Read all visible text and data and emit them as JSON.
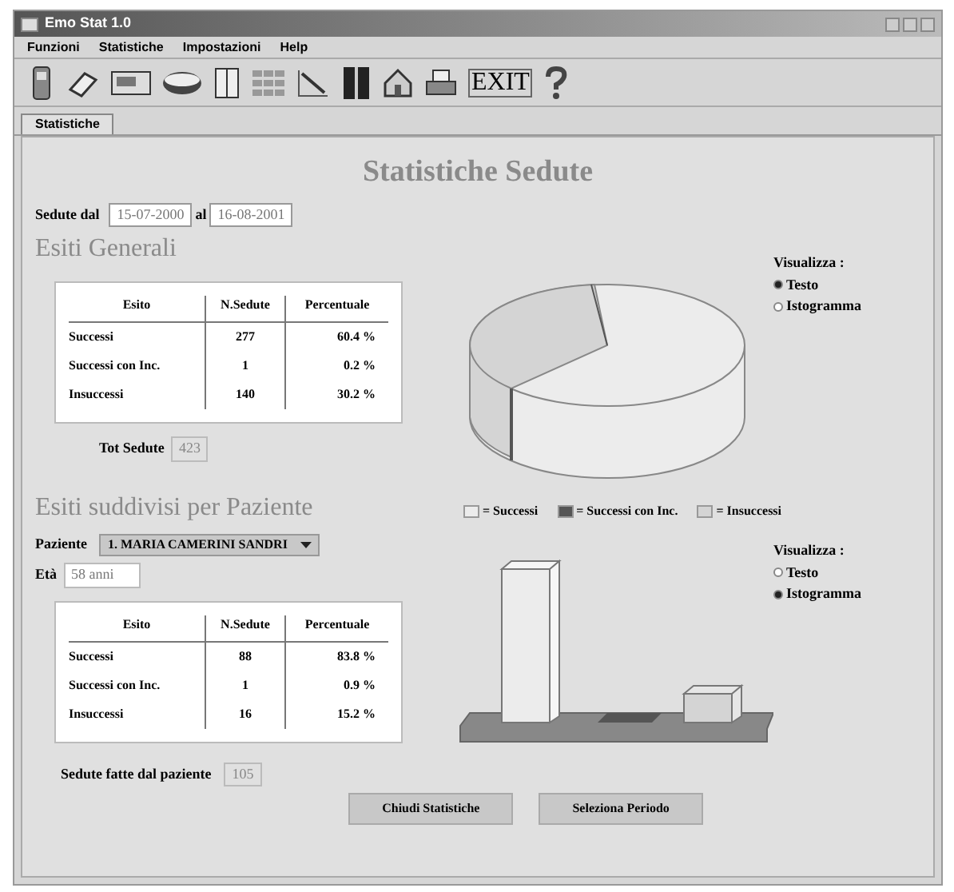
{
  "window": {
    "title": "Emo Stat 1.0"
  },
  "menu": [
    "Funzioni",
    "Statistiche",
    "Impostazioni",
    "Help"
  ],
  "toolbar": {
    "exit_label": "EXIT"
  },
  "tabs": [
    {
      "label": "Statistiche",
      "selected": true
    }
  ],
  "heading": "Statistiche Sedute",
  "period": {
    "label": "Sedute dal",
    "from": "15-07-2000",
    "sep": "al",
    "to": "16-08-2001"
  },
  "general": {
    "title": "Esiti Generali",
    "columns": [
      "Esito",
      "N.Sedute",
      "Percentuale"
    ],
    "rows": [
      [
        "Successi",
        "277",
        "60.4 %"
      ],
      [
        "Successi con Inc.",
        "1",
        "0.2 %"
      ],
      [
        "Insuccessi",
        "140",
        "30.2 %"
      ]
    ],
    "total_label": "Tot Sedute",
    "total": "423",
    "view": {
      "label": "Visualizza :",
      "options": [
        {
          "label": "Testo",
          "selected": true
        },
        {
          "label": "Istogramma",
          "selected": false
        }
      ]
    }
  },
  "legend": [
    {
      "label": "= Successi",
      "color": "#ececec"
    },
    {
      "label": "= Successi con Inc.",
      "color": "#555555"
    },
    {
      "label": "= Insuccessi",
      "color": "#d4d4d4"
    }
  ],
  "patient": {
    "title": "Esiti suddivisi per Paziente",
    "label": "Paziente",
    "value": "1. MARIA CAMERINI SANDRI",
    "age_label": "Età",
    "age": "58 anni",
    "columns": [
      "Esito",
      "N.Sedute",
      "Percentuale"
    ],
    "rows": [
      [
        "Successi",
        "88",
        "83.8 %"
      ],
      [
        "Successi con Inc.",
        "1",
        "0.9 %"
      ],
      [
        "Insuccessi",
        "16",
        "15.2 %"
      ]
    ],
    "total_label": "Sedute fatte dal paziente",
    "total": "105",
    "view": {
      "label": "Visualizza :",
      "options": [
        {
          "label": "Testo",
          "selected": false
        },
        {
          "label": "Istogramma",
          "selected": true
        }
      ]
    }
  },
  "buttons": [
    "Chiudi Statistiche",
    "Seleziona Periodo"
  ]
}
